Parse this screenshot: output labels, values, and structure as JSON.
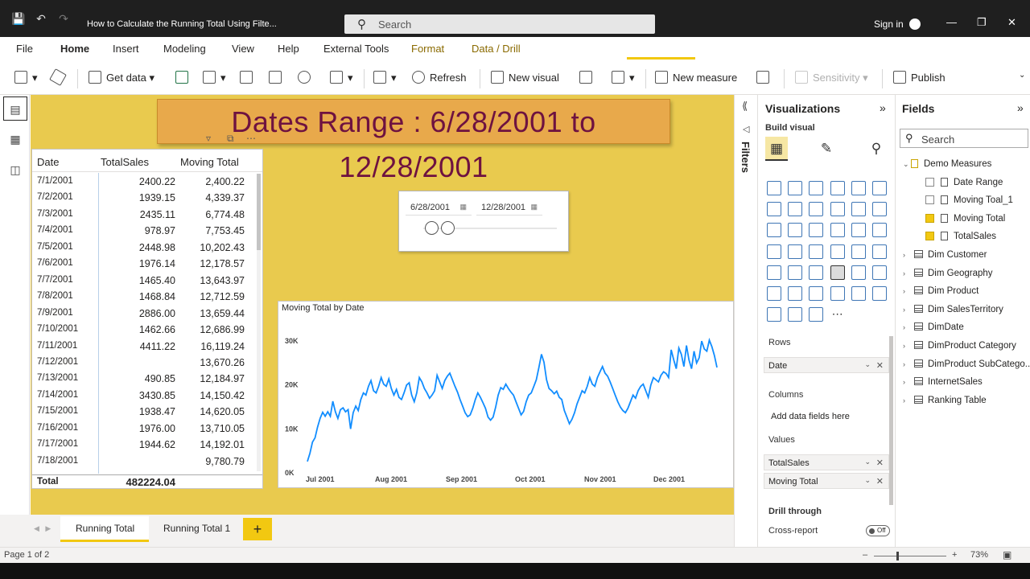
{
  "window": {
    "title": "How to Calculate the Running Total Using Filte...",
    "search_placeholder": "Search",
    "signin": "Sign in"
  },
  "menu": [
    "File",
    "Home",
    "Insert",
    "Modeling",
    "View",
    "Help",
    "External Tools",
    "Format",
    "Data / Drill"
  ],
  "ribbon": {
    "get_data": "Get data",
    "refresh": "Refresh",
    "new_visual": "New visual",
    "new_measure": "New measure",
    "sensitivity": "Sensitivity",
    "publish": "Publish"
  },
  "report": {
    "banner": "Dates Range : 6/28/2001 to 12/28/2001",
    "table": {
      "headers": [
        "Date",
        "TotalSales",
        "Moving Total"
      ],
      "rows": [
        [
          "7/1/2001",
          "2400.22",
          "2,400.22"
        ],
        [
          "7/2/2001",
          "1939.15",
          "4,339.37"
        ],
        [
          "7/3/2001",
          "2435.11",
          "6,774.48"
        ],
        [
          "7/4/2001",
          "978.97",
          "7,753.45"
        ],
        [
          "7/5/2001",
          "2448.98",
          "10,202.43"
        ],
        [
          "7/6/2001",
          "1976.14",
          "12,178.57"
        ],
        [
          "7/7/2001",
          "1465.40",
          "13,643.97"
        ],
        [
          "7/8/2001",
          "1468.84",
          "12,712.59"
        ],
        [
          "7/9/2001",
          "2886.00",
          "13,659.44"
        ],
        [
          "7/10/2001",
          "1462.66",
          "12,686.99"
        ],
        [
          "7/11/2001",
          "4411.22",
          "16,119.24"
        ],
        [
          "7/12/2001",
          "",
          "13,670.26"
        ],
        [
          "7/13/2001",
          "490.85",
          "12,184.97"
        ],
        [
          "7/14/2001",
          "3430.85",
          "14,150.42"
        ],
        [
          "7/15/2001",
          "1938.47",
          "14,620.05"
        ],
        [
          "7/16/2001",
          "1976.00",
          "13,710.05"
        ],
        [
          "7/17/2001",
          "1944.62",
          "14,192.01"
        ],
        [
          "7/18/2001",
          "",
          "9,780.79"
        ]
      ],
      "total_label": "Total",
      "total_value": "482224.04"
    },
    "slicer": {
      "start": "6/28/2001",
      "end": "12/28/2001"
    }
  },
  "chart_data": {
    "type": "line",
    "title": "Moving Total by Date",
    "xlabel": "",
    "ylabel": "",
    "x_ticks": [
      "Jul 2001",
      "Aug 2001",
      "Sep 2001",
      "Oct 2001",
      "Nov 2001",
      "Dec 2001"
    ],
    "y_ticks": [
      "0K",
      "10K",
      "20K",
      "30K"
    ],
    "ylim": [
      0,
      30000
    ],
    "grid": false,
    "series": [
      {
        "color": "#118dff",
        "x_range": [
          "2001-07-01",
          "2001-12-28"
        ],
        "values": [
          2400,
          4300,
          6800,
          7800,
          10200,
          12200,
          13600,
          12700,
          13700,
          12700,
          16100,
          13700,
          12200,
          14200,
          14600,
          13700,
          14200,
          9800,
          13500,
          15000,
          14000,
          16500,
          18000,
          17500,
          19500,
          20800,
          18500,
          18000,
          19500,
          21500,
          20000,
          19500,
          21200,
          19000,
          17500,
          18800,
          17000,
          16500,
          18000,
          19800,
          20300,
          17500,
          16000,
          18000,
          21500,
          20500,
          19000,
          18000,
          16800,
          17500,
          18500,
          22000,
          20500,
          19000,
          20800,
          21800,
          22500,
          21000,
          19500,
          18200,
          16500,
          15000,
          13500,
          12600,
          13000,
          14500,
          16500,
          18000,
          17000,
          15800,
          14500,
          12500,
          11800,
          12500,
          14800,
          17500,
          19200,
          18800,
          20000,
          19000,
          18200,
          17500,
          16000,
          14500,
          13000,
          13800,
          16000,
          17500,
          18000,
          19500,
          21000,
          23800,
          26800,
          25000,
          21000,
          19000,
          18500,
          17800,
          18400,
          17000,
          16500,
          14000,
          12500,
          11000,
          12000,
          13500,
          15500,
          17000,
          18500,
          18000,
          19500,
          21500,
          20000,
          19500,
          21500,
          22800,
          24000,
          22500,
          21800,
          20500,
          19000,
          17500,
          16000,
          14800,
          14000,
          13500,
          14500,
          16000,
          17500,
          16800,
          18500,
          19500,
          20000,
          18500,
          17000,
          19800,
          21500,
          21000,
          20500,
          22000,
          22800,
          22400,
          21500,
          27800,
          25500,
          23500,
          28200,
          26800,
          24000,
          28800,
          25500,
          23500,
          27500,
          24800,
          26000,
          29800,
          28000,
          27500,
          30000,
          28500,
          26500,
          23800
        ]
      }
    ]
  },
  "tabs": [
    "Running Total",
    "Running Total 1"
  ],
  "viz_pane": {
    "title": "Visualizations",
    "build_visual": "Build visual",
    "rows_label": "Rows",
    "rows_field": "Date",
    "columns_label": "Columns",
    "columns_placeholder": "Add data fields here",
    "values_label": "Values",
    "values_fields": [
      "TotalSales",
      "Moving Total"
    ],
    "drill_through": "Drill through",
    "cross_report": "Cross-report",
    "toggle": "Off"
  },
  "filters_label": "Filters",
  "fields_pane": {
    "title": "Fields",
    "search_placeholder": "Search",
    "measures_group": "Demo Measures",
    "measures": [
      "Date Range",
      "Moving Toal_1",
      "Moving Total",
      "TotalSales"
    ],
    "tables": [
      "Dim Customer",
      "Dim Geography",
      "Dim Product",
      "Dim SalesTerritory",
      "DimDate",
      "DimProduct Category",
      "DimProduct SubCatego...",
      "InternetSales",
      "Ranking Table"
    ]
  },
  "status": {
    "page": "Page 1 of 2",
    "zoom": "73%"
  }
}
